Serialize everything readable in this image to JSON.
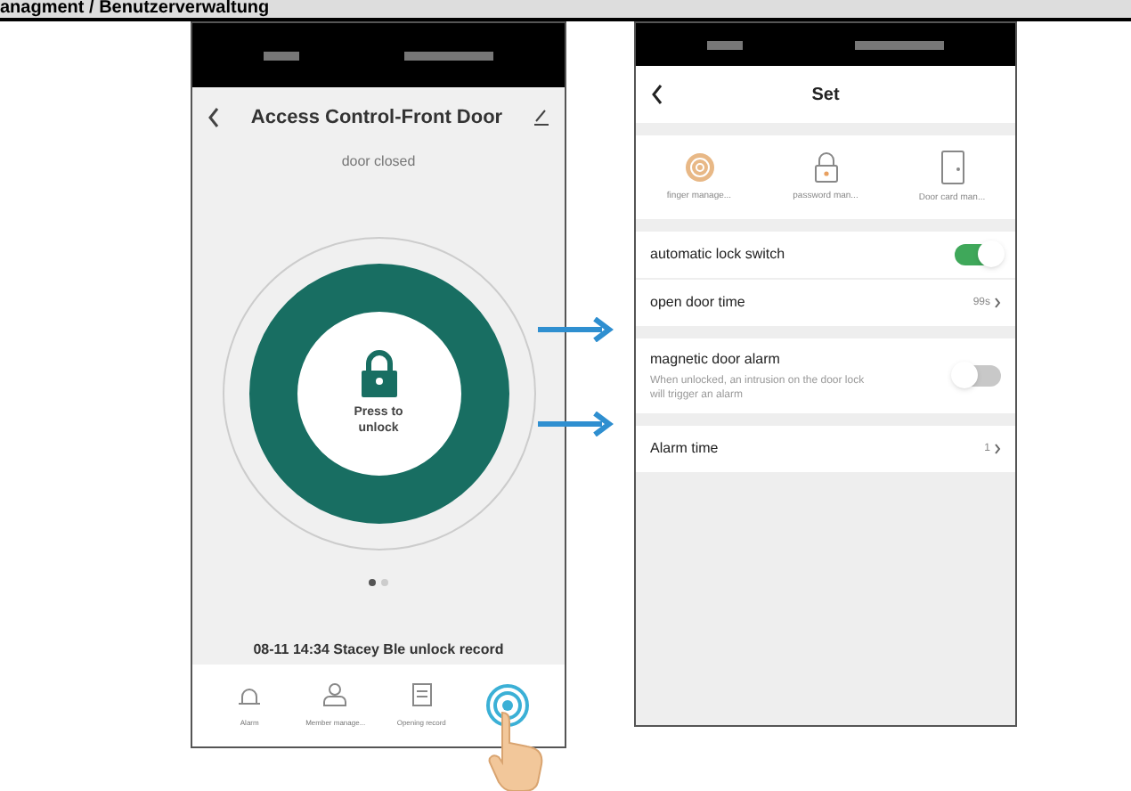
{
  "page_heading": "anagment / Benutzerverwaltung",
  "left_phone": {
    "title": "Access Control-Front Door",
    "status": "door closed",
    "unlock_button": "Press to\nunlock",
    "pager": [
      {
        "selected": true
      },
      {
        "selected": false
      }
    ],
    "record": "08-11 14:34 Stacey Ble unlock record",
    "nav": [
      {
        "kind": "alarm",
        "label": "Alarm"
      },
      {
        "kind": "member",
        "label": "Member manage..."
      },
      {
        "kind": "record",
        "label": "Opening record"
      }
    ]
  },
  "right_phone": {
    "title": "Set",
    "shortcuts": [
      {
        "kind": "finger",
        "label": "finger manage..."
      },
      {
        "kind": "password",
        "label": "password man..."
      },
      {
        "kind": "card",
        "label": "Door card man..."
      }
    ],
    "setting_groups": [
      [
        {
          "kind": "switch",
          "label": "automatic lock switch",
          "on": true
        },
        {
          "kind": "link",
          "label": "open door time",
          "value": "99s"
        }
      ],
      [
        {
          "kind": "switch",
          "label": "magnetic door alarm",
          "description": "When unlocked, an intrusion on the door lock will trigger an alarm",
          "on": false
        }
      ],
      [
        {
          "kind": "link",
          "label": "Alarm time",
          "value": "1"
        }
      ]
    ]
  }
}
